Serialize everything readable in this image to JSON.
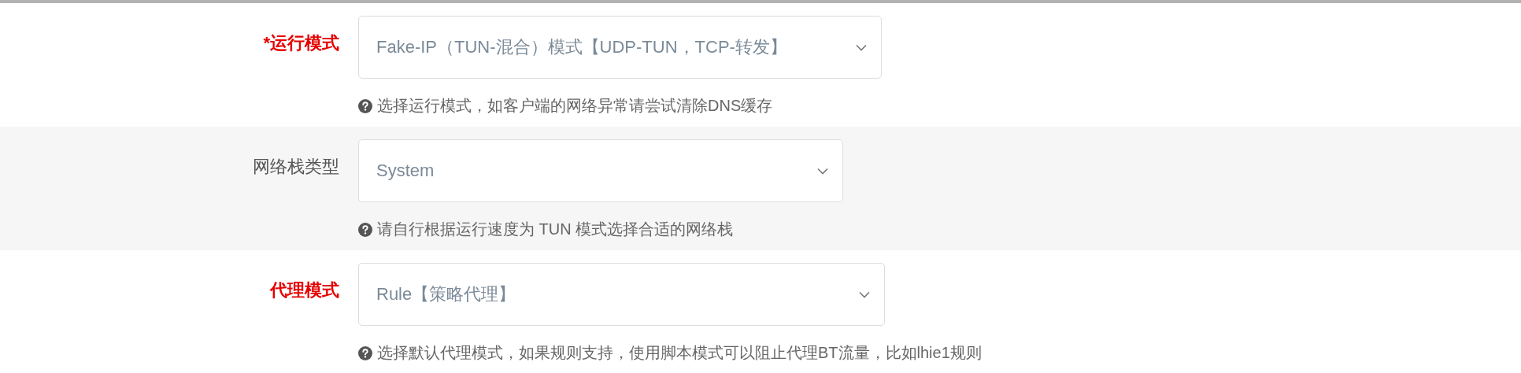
{
  "fields": [
    {
      "label": "*运行模式",
      "emphasized": true,
      "value": "Fake-IP（TUN-混合）模式【UDP-TUN，TCP-转发】",
      "help": "选择运行模式，如客户端的网络异常请尝试清除DNS缓存"
    },
    {
      "label": "网络栈类型",
      "emphasized": false,
      "value": "System",
      "help": "请自行根据运行速度为 TUN 模式选择合适的网络栈"
    },
    {
      "label": "代理模式",
      "emphasized": true,
      "value": "Rule【策略代理】",
      "help": "选择默认代理模式，如果规则支持，使用脚本模式可以阻止代理BT流量，比如lhie1规则"
    }
  ]
}
